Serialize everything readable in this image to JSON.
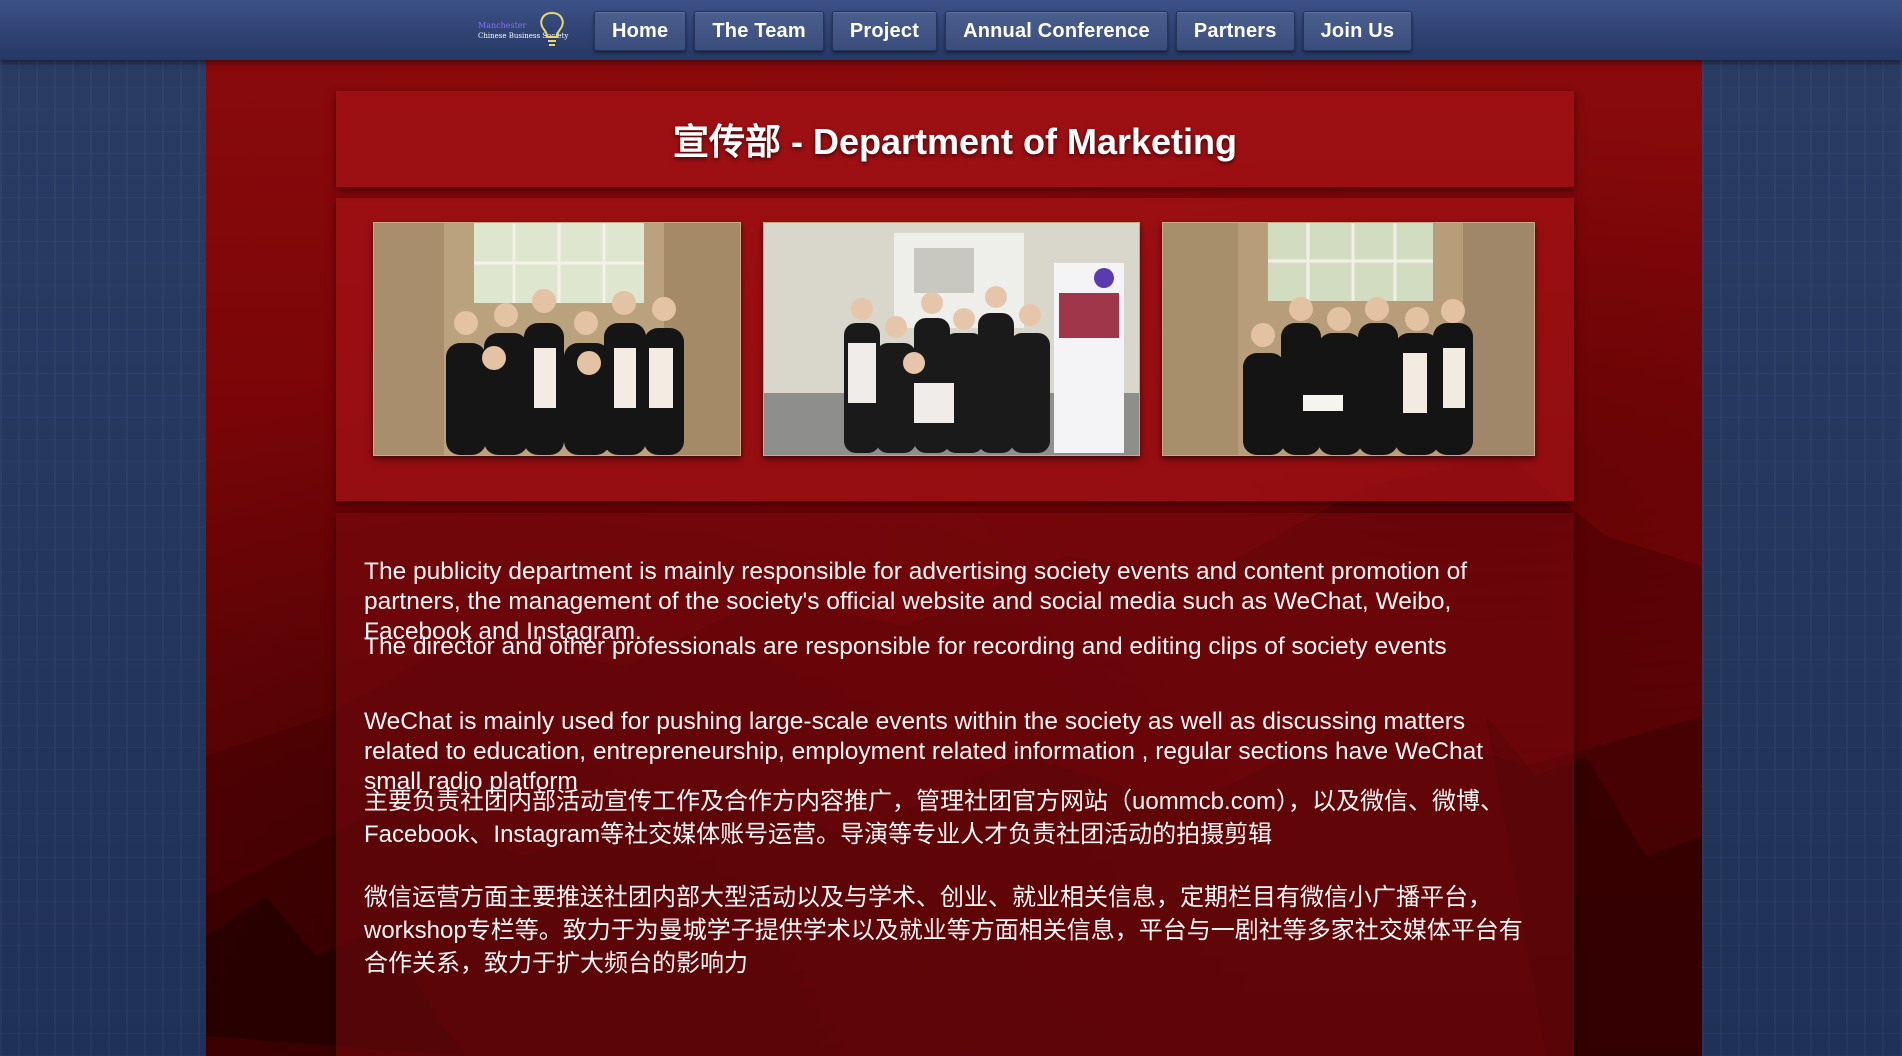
{
  "logo": {
    "line1": "Manchester",
    "line2": "Chinese Business Society"
  },
  "nav": [
    "Home",
    "The Team",
    "Project",
    "Annual Conference",
    "Partners",
    "Join Us"
  ],
  "page_title": "宣传部 - Department of Marketing",
  "photos": [
    {
      "alt": "team photo 1"
    },
    {
      "alt": "team photo 2"
    },
    {
      "alt": "team photo 3"
    }
  ],
  "en_paragraph_1": "The publicity department is mainly responsible for advertising society events and content promotion of partners, the management of the society's official website and social media such as WeChat, Weibo, Facebook and Instagram.",
  "en_paragraph_2": "The director and other professionals are responsible for recording and editing clips of society events",
  "en_paragraph_3": "WeChat is mainly used for pushing large-scale events within the society as well as discussing matters related to education, entrepreneurship, employment related information , regular sections have WeChat small radio platform",
  "zh_paragraph_1": "主要负责社团内部活动宣传工作及合作方内容推广，管理社团官方网站（uommcb.com），以及微信、微博、Facebook、Instagram等社交媒体账号运营。导演等专业人才负责社团活动的拍摄剪辑",
  "zh_paragraph_2": "微信运营方面主要推送社团内部大型活动以及与学术、创业、就业相关信息，定期栏目有微信小广播平台，workshop专栏等。致力于为曼城学子提供学术以及就业等方面相关信息，平台与一剧社等多家社交媒体平台有合作关系，致力于扩大频台的影响力",
  "colors": {
    "header": "#2f4373",
    "panel": "#7a0508",
    "card": "#a51216",
    "accent_logo": "#8a6cff"
  }
}
